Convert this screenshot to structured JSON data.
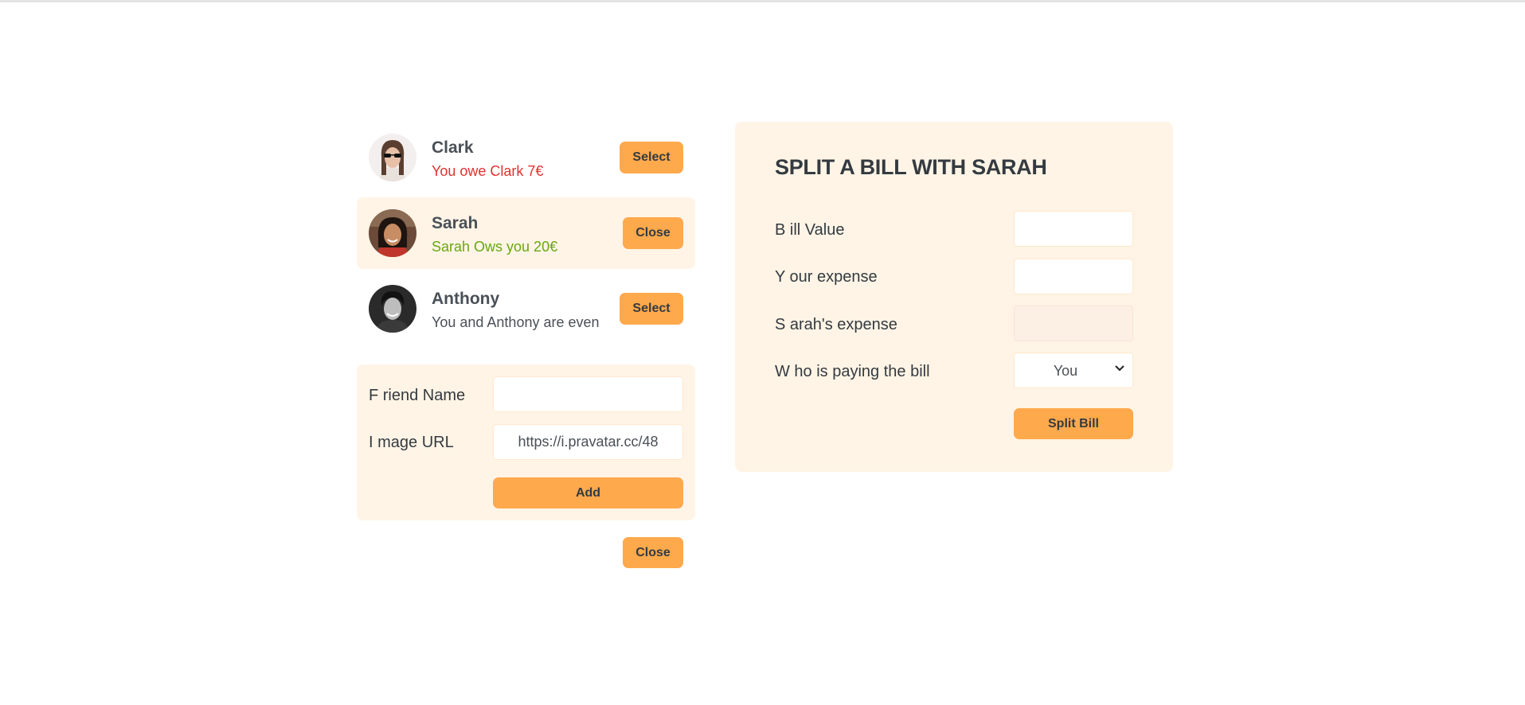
{
  "friends": [
    {
      "name": "Clark",
      "status": "You owe Clark 7€",
      "status_type": "owe",
      "button": "Select",
      "selected": false,
      "avatar_icon": "person-photo"
    },
    {
      "name": "Sarah",
      "status": "Sarah Ows you 20€",
      "status_type": "owed",
      "button": "Close",
      "selected": true,
      "avatar_icon": "person-photo"
    },
    {
      "name": "Anthony",
      "status": "You and Anthony are even",
      "status_type": "even",
      "button": "Select",
      "selected": false,
      "avatar_icon": "person-photo"
    }
  ],
  "add_friend": {
    "name_label": "F riend Name",
    "name_value": "",
    "image_label": "I mage URL",
    "image_value": "https://i.pravatar.cc/48",
    "add_button": "Add"
  },
  "close_button": "Close",
  "split": {
    "title": "SPLIT A BILL WITH SARAH",
    "bill_label": "B ill Value",
    "bill_value": "",
    "expense_label": "Y our expense",
    "expense_value": "",
    "friend_expense_label": "S arah's expense",
    "friend_expense_value": "",
    "payer_label": "W ho is paying the bill",
    "payer_value": "You",
    "split_button": "Split Bill"
  },
  "colors": {
    "accent": "#ffa94d",
    "panel": "#fff4e6",
    "red": "#e03131",
    "green": "#66a80f"
  }
}
